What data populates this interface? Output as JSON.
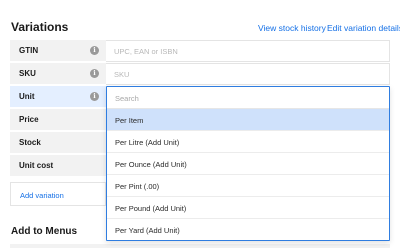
{
  "header": {
    "title": "Variations",
    "view_stock_history": "View stock history",
    "edit_variation_details": "Edit variation details"
  },
  "fields": {
    "gtin": {
      "label": "GTIN",
      "placeholder": "UPC, EAN or ISBN"
    },
    "sku": {
      "label": "SKU",
      "placeholder": "SKU"
    },
    "unit": {
      "label": "Unit"
    },
    "price": {
      "label": "Price"
    },
    "stock": {
      "label": "Stock"
    },
    "unit_cost": {
      "label": "Unit cost"
    }
  },
  "info_glyph": "i",
  "add_variation": "Add variation",
  "menus_title": "Add to Menus",
  "unit_dropdown": {
    "search_placeholder": "Search",
    "selected": "Per Item",
    "options": [
      "Per Item",
      "Per Litre (Add Unit)",
      "Per Ounce (Add Unit)",
      "Per Pint (.00)",
      "Per Pound (Add Unit)",
      "Per Yard (Add Unit)"
    ]
  },
  "colors": {
    "accent": "#1570e6",
    "selected_bg": "#cfe1fb",
    "label_bg": "#f2f2f2"
  }
}
